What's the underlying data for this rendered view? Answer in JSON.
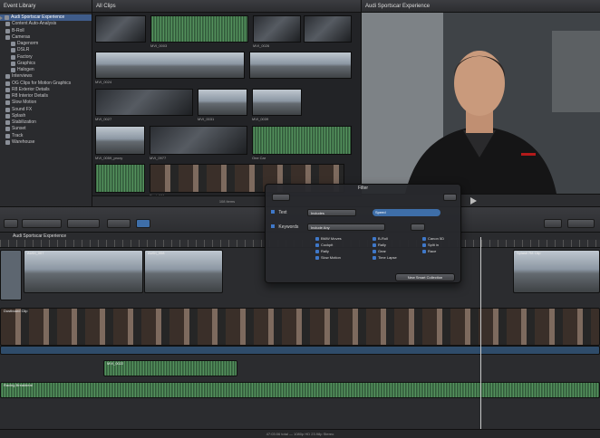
{
  "library": {
    "title": "Event Library",
    "event_name": "Audi Sportscar Experience",
    "items": [
      {
        "label": "Content Auto-Analysis",
        "indent": 1
      },
      {
        "label": "B-Roll",
        "indent": 1
      },
      {
        "label": "Cameras",
        "indent": 1
      },
      {
        "label": "Dagenorm",
        "indent": 2
      },
      {
        "label": "DSLR",
        "indent": 2
      },
      {
        "label": "Factory",
        "indent": 2
      },
      {
        "label": "Graphics",
        "indent": 2
      },
      {
        "label": "Halogen",
        "indent": 2
      },
      {
        "label": "Interviews",
        "indent": 1
      },
      {
        "label": "OG Clips for Motion Graphics",
        "indent": 1
      },
      {
        "label": "R8 Exterior Details",
        "indent": 1
      },
      {
        "label": "R8 Interior Details",
        "indent": 1
      },
      {
        "label": "Slow Motion",
        "indent": 1
      },
      {
        "label": "Sound FX",
        "indent": 1
      },
      {
        "label": "Splash",
        "indent": 1
      },
      {
        "label": "Stabilization",
        "indent": 1
      },
      {
        "label": "Sunset",
        "indent": 1
      },
      {
        "label": "Track",
        "indent": 1
      },
      {
        "label": "Warehouse",
        "indent": 1
      }
    ]
  },
  "browser": {
    "title": "All Clips",
    "clips": [
      {
        "label": ""
      },
      {
        "label": "MVI_0003"
      },
      {
        "label": "MVI_0026"
      },
      {
        "label": "MVI_0024"
      },
      {
        "label": ""
      },
      {
        "label": "MVI_0027"
      },
      {
        "label": "MVI_0031"
      },
      {
        "label": "MVI_0039"
      },
      {
        "label": "MVI_0059_proxy"
      },
      {
        "label": "MVI_0977"
      },
      {
        "label": "One Car"
      },
      {
        "label": ""
      },
      {
        "label": "Pacl_001"
      }
    ],
    "footer": "108 items"
  },
  "viewer": {
    "title": "Audi Sportscar Experience"
  },
  "timeline": {
    "project": "Audi Sportscar Experience",
    "clips": {
      "top_a": "AUDI_007",
      "top_b": "AUDI_008",
      "top_c": "Splash R8 Clip",
      "interview": "Dustboard Clip",
      "audio_a": "MVI_0022",
      "music": "Racing Breakbeat"
    },
    "status": "47:03:06 total — 1080p HD 23.98p Stereo"
  },
  "filter": {
    "title": "Filter",
    "row1_label": "Text",
    "row1_popup": "Includes",
    "row1_value": "Speed",
    "row2_label": "Keywords",
    "row2_popup": "Include Any",
    "keywords": [
      "BMW Moves",
      "B-Roll",
      "Canon 5D",
      "Cockpit",
      "Rally",
      "Split in",
      "Rally",
      "Gear",
      "Race",
      "Slow Motion",
      "Time Lapse",
      ""
    ],
    "new_button": "New Smart Collection"
  },
  "colors": {
    "selection": "#3f5c8a",
    "accent_blue": "#3e6ea8",
    "audio_green": "#54925d"
  }
}
